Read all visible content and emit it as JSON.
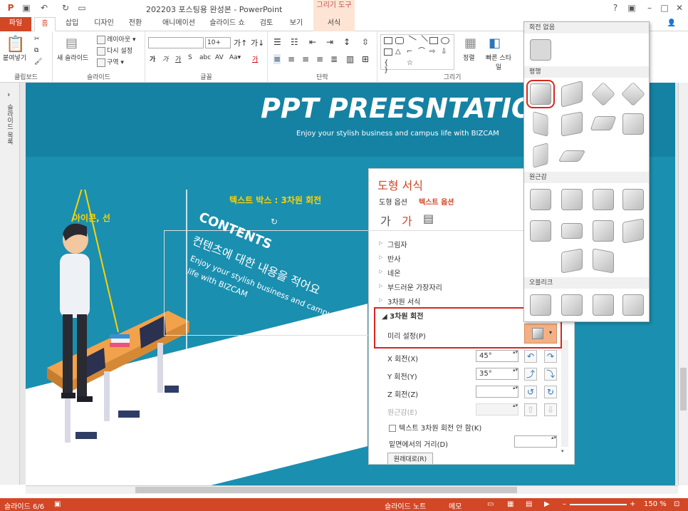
{
  "window": {
    "title": "202203 포스팅용 완성본 - PowerPoint",
    "contextual_tab_group": "그리기 도구"
  },
  "tabs": [
    "파일",
    "홈",
    "삽입",
    "디자인",
    "전환",
    "애니메이션",
    "슬라이드 쇼",
    "검토",
    "보기",
    "서식"
  ],
  "ribbon": {
    "paste": "붙여넣기",
    "new_slide": "새 슬라이드",
    "layout": "레이아웃",
    "reset": "다시 설정",
    "section": "구역",
    "font_size": "10+",
    "arrange": "정렬",
    "quick_styles": "빠른 스타일",
    "groups": {
      "clipboard": "클립보드",
      "slides": "슬라이드",
      "font": "글꼴",
      "paragraph": "단락",
      "drawing": "그리기"
    }
  },
  "left_panel": {
    "label": "슬라이드 목록"
  },
  "slide": {
    "title": "PPT PREESNTATION",
    "subtitle": "Enjoy your stylish business and campus life with BIZCAM",
    "annotation_textbox": "텍스트 박스 : 3차원 회전",
    "annotation_icon": "아이콘, 선",
    "contents_title": "CONTENTS",
    "contents_korean": "컨텐츠에 대한 내용을 적어요",
    "contents_english1": "Enjoy your stylish business and campus",
    "contents_english2": "life with BIZCAM"
  },
  "format_pane": {
    "title": "도형 서식",
    "shape_options": "도형 옵션",
    "text_options": "텍스트 옵션",
    "sections": [
      "그림자",
      "반사",
      "네온",
      "부드러운 가장자리",
      "3차원 서식"
    ],
    "rotation_section": "3차원 회전",
    "preset_label": "미리 설정(P)",
    "x_rotation_label": "X 회전(X)",
    "x_rotation_value": "45°",
    "y_rotation_label": "Y 회전(Y)",
    "y_rotation_value": "35°",
    "z_rotation_label": "Z 회전(Z)",
    "z_rotation_value": "",
    "perspective_label": "원근감(E)",
    "keep_text_flat": "텍스트 3차원 회전 안 함(K)",
    "distance_label": "밑면에서의 거리(D)",
    "reset_label": "원래대로(R)"
  },
  "gallery": {
    "no_rotation": "회전 없음",
    "parallel": "평행",
    "perspective": "원근감",
    "oblique": "오블리크"
  },
  "status": {
    "slide": "슬라이드 6/6",
    "notes": "슬라이드 노트",
    "comments": "메모",
    "zoom": "150 %"
  },
  "colors": {
    "accent": "#d24726",
    "slide_bg": "#1a8fb0",
    "highlight": "#d9261c",
    "annotation": "#ffd200"
  }
}
